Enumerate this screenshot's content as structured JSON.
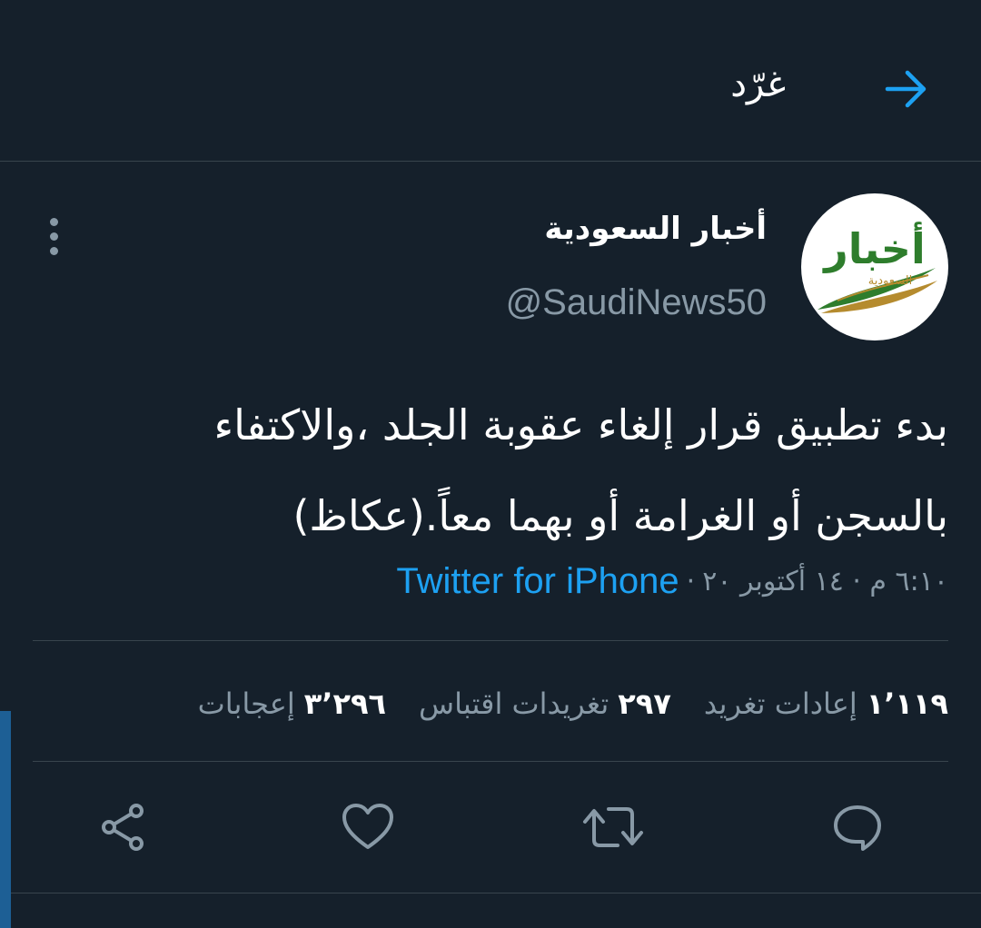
{
  "header": {
    "title": "غرّد",
    "back_icon": "arrow-right-icon"
  },
  "tweet": {
    "avatar": {
      "logo_text": "أخبار",
      "logo_sub": "السعودية",
      "colors": {
        "green": "#2e7d2c",
        "gold": "#b58b2e"
      }
    },
    "display_name": "أخبار السعودية",
    "handle": "@SaudiNews50",
    "text_line1": "بدء تطبيق قرار إلغاء عقوبة الجلد ،والاكتفاء",
    "text_line2": "بالسجن أو الغرامة أو بهما معاً.(عكاظ)",
    "time": "٦:١٠ م · ١٤ أكتوبر ٢٠",
    "separator": "·",
    "source": "Twitter for iPhone"
  },
  "stats": {
    "retweets_count": "١٬١١٩",
    "retweets_label": "إعادات تغريد",
    "quotes_count": "٢٩٧",
    "quotes_label": "تغريدات اقتباس",
    "likes_count": "٣٬٢٩٦",
    "likes_label": "إعجابات"
  },
  "actions": [
    "reply-icon",
    "retweet-icon",
    "like-icon",
    "share-icon"
  ],
  "colors": {
    "background": "#15202b",
    "divider": "#38444d",
    "secondary_text": "#8899a6",
    "accent": "#1da1f2"
  }
}
